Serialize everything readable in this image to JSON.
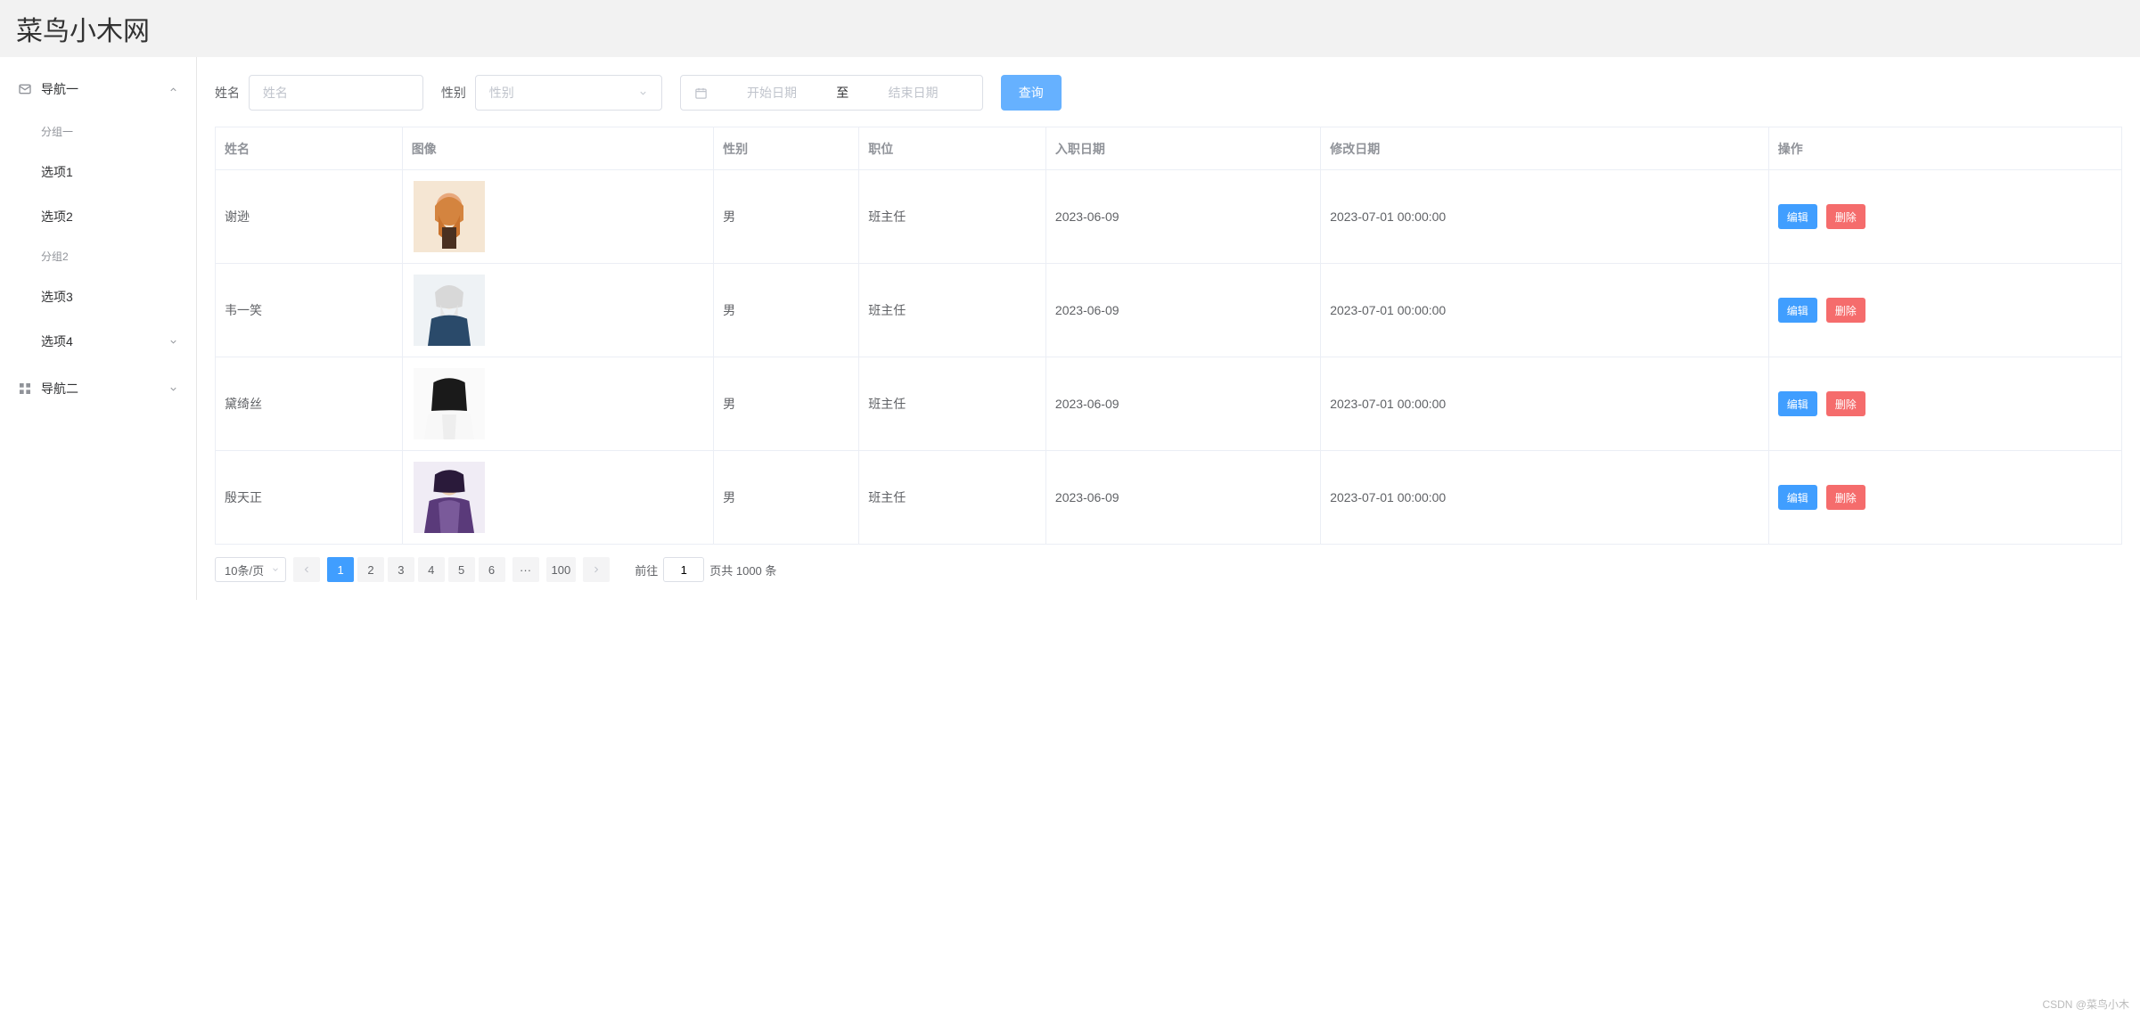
{
  "header": {
    "title": "菜鸟小木网"
  },
  "sidebar": {
    "nav1": {
      "label": "导航一",
      "open": true
    },
    "group1": "分组一",
    "opt1": "选项1",
    "opt2": "选项2",
    "group2": "分组2",
    "opt3": "选项3",
    "opt4": "选项4",
    "nav2": {
      "label": "导航二",
      "open": false
    }
  },
  "filter": {
    "name_label": "姓名",
    "name_placeholder": "姓名",
    "gender_label": "性别",
    "gender_placeholder": "性别",
    "date_start_placeholder": "开始日期",
    "date_sep": "至",
    "date_end_placeholder": "结束日期",
    "query_btn": "查询"
  },
  "table": {
    "headers": {
      "name": "姓名",
      "avatar": "图像",
      "gender": "性别",
      "position": "职位",
      "join": "入职日期",
      "modify": "修改日期",
      "ops": "操作"
    },
    "edit_btn": "编辑",
    "del_btn": "删除",
    "rows": [
      {
        "name": "谢逊",
        "avatar": "a1",
        "gender": "男",
        "position": "班主任",
        "join": "2023-06-09",
        "modify": "2023-07-01 00:00:00"
      },
      {
        "name": "韦一笑",
        "avatar": "a2",
        "gender": "男",
        "position": "班主任",
        "join": "2023-06-09",
        "modify": "2023-07-01 00:00:00"
      },
      {
        "name": "黛绮丝",
        "avatar": "a3",
        "gender": "男",
        "position": "班主任",
        "join": "2023-06-09",
        "modify": "2023-07-01 00:00:00"
      },
      {
        "name": "殷天正",
        "avatar": "a4",
        "gender": "男",
        "position": "班主任",
        "join": "2023-06-09",
        "modify": "2023-07-01 00:00:00"
      }
    ]
  },
  "pagination": {
    "page_size": "10条/页",
    "pages": [
      "1",
      "2",
      "3",
      "4",
      "5",
      "6"
    ],
    "ellipsis": "···",
    "last": "100",
    "current": "1",
    "jump_prefix": "前往",
    "jump_value": "1",
    "jump_suffix": "页共 1000 条"
  },
  "watermark": "CSDN @菜鸟小木"
}
